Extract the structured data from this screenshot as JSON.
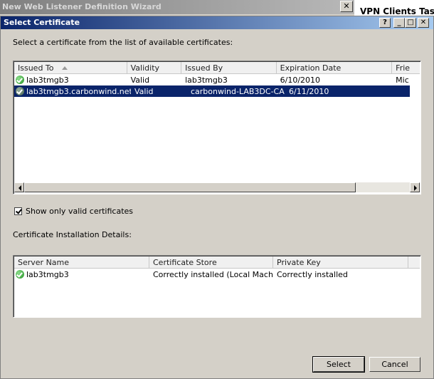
{
  "background_window": {
    "title": "New Web Listener Definition Wizard",
    "side_text": "VPN Clients Tasl"
  },
  "dialog": {
    "title": "Select Certificate",
    "title_buttons": {
      "help": "?",
      "minimize": "_",
      "maximize": "□",
      "close": "✕"
    },
    "intro_text": "Select a certificate from the list of available certificates:",
    "certificates": {
      "columns": [
        {
          "label": "Issued To",
          "sorted": "ascending"
        },
        {
          "label": "Validity"
        },
        {
          "label": "Issued By"
        },
        {
          "label": "Expiration Date"
        },
        {
          "label": "Frie"
        }
      ],
      "rows": [
        {
          "issued_to": "lab3tmgb3",
          "validity": "Valid",
          "issued_by": "lab3tmgb3",
          "expiration": "6/10/2010",
          "friendly": "Mic",
          "selected": false,
          "icon": "certificate-valid-icon"
        },
        {
          "issued_to": "lab3tmgb3.carbonwind.net",
          "validity": "Valid",
          "issued_by": "carbonwind-LAB3DC-CA",
          "expiration": "6/11/2010",
          "friendly": "",
          "selected": true,
          "icon": "certificate-valid-icon"
        }
      ]
    },
    "show_only_valid": {
      "label": "Show only valid certificates",
      "checked": true
    },
    "installation_label": "Certificate Installation Details:",
    "installation": {
      "columns": [
        {
          "label": "Server Name"
        },
        {
          "label": "Certificate Store"
        },
        {
          "label": "Private Key"
        }
      ],
      "rows": [
        {
          "server": "lab3tmgb3",
          "store": "Correctly installed (Local Machi...",
          "key": "Correctly installed",
          "icon": "certificate-valid-icon"
        }
      ]
    },
    "buttons": {
      "select": "Select",
      "cancel": "Cancel"
    }
  },
  "colors": {
    "title_active": "#0a246a",
    "selection": "#0a246a",
    "face": "#d4d0c8"
  }
}
